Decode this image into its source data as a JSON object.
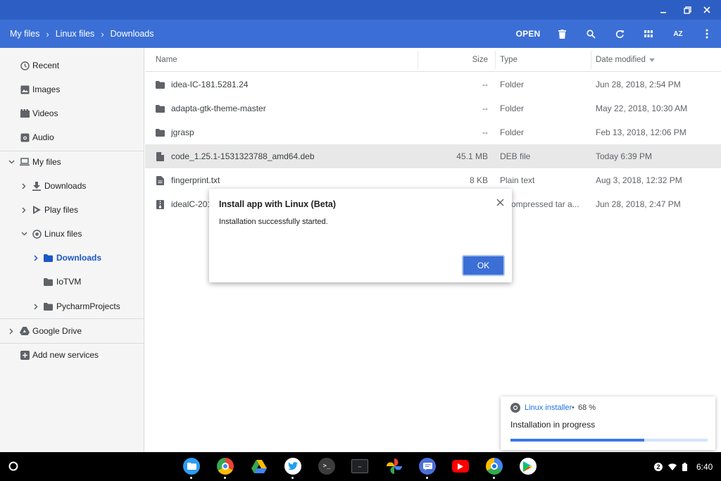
{
  "breadcrumb": {
    "items": [
      "My files",
      "Linux files",
      "Downloads"
    ]
  },
  "toolbar": {
    "open_label": "OPEN",
    "sort_label": "AZ"
  },
  "sidebar": {
    "items": [
      {
        "label": "Recent",
        "icon": "clock-icon"
      },
      {
        "label": "Images",
        "icon": "image-icon"
      },
      {
        "label": "Videos",
        "icon": "video-icon"
      },
      {
        "label": "Audio",
        "icon": "audio-icon"
      },
      {
        "label": "My files",
        "icon": "laptop-icon"
      },
      {
        "label": "Downloads",
        "icon": "download-icon"
      },
      {
        "label": "Play files",
        "icon": "play-store-icon"
      },
      {
        "label": "Linux files",
        "icon": "linux-icon"
      },
      {
        "label": "Downloads",
        "icon": "folder-icon"
      },
      {
        "label": "IoTVM",
        "icon": "folder-icon"
      },
      {
        "label": "PycharmProjects",
        "icon": "folder-icon"
      },
      {
        "label": "Google Drive",
        "icon": "drive-icon"
      },
      {
        "label": "Add new services",
        "icon": "add-box-icon"
      }
    ]
  },
  "columns": {
    "name": "Name",
    "size": "Size",
    "type": "Type",
    "date": "Date modified"
  },
  "files": [
    {
      "name": "idea-IC-181.5281.24",
      "size": "--",
      "type": "Folder",
      "date": "Jun 28, 2018, 2:54 PM",
      "icon": "folder-icon"
    },
    {
      "name": "adapta-gtk-theme-master",
      "size": "--",
      "type": "Folder",
      "date": "May 22, 2018, 10:30 AM",
      "icon": "folder-icon"
    },
    {
      "name": "jgrasp",
      "size": "--",
      "type": "Folder",
      "date": "Feb 13, 2018, 12:06 PM",
      "icon": "folder-icon"
    },
    {
      "name": "code_1.25.1-1531323788_amd64.deb",
      "size": "45.1 MB",
      "type": "DEB file",
      "date": "Today 6:39 PM",
      "icon": "file-icon"
    },
    {
      "name": "fingerprint.txt",
      "size": "8 KB",
      "type": "Plain text",
      "date": "Aug 3, 2018, 12:32 PM",
      "icon": "text-file-icon"
    },
    {
      "name": "idealC-201",
      "size": "",
      "type": "p compressed tar a...",
      "date": "Jun 28, 2018, 2:47 PM",
      "icon": "archive-icon"
    }
  ],
  "dialog": {
    "title": "Install app with Linux (Beta)",
    "message": "Installation successfully started.",
    "ok_label": "OK"
  },
  "notification": {
    "app": "Linux installer",
    "separator": "•",
    "percent_text": "68 %",
    "progress": 0.68,
    "message": "Installation in progress"
  },
  "shelf": {
    "apps": [
      "files-app-icon",
      "chrome-icon",
      "google-drive-icon",
      "twitter-icon",
      "terminal-icon",
      "crosh-icon",
      "photos-icon",
      "messages-icon",
      "youtube-icon",
      "chrome-beta-icon",
      "play-store-icon"
    ],
    "notification_count": "2",
    "time": "6:40"
  },
  "colors": {
    "appbar": "#3b6fd6",
    "titlebar": "#2d5ec3",
    "accent": "#1a57c7",
    "selected_row": "#e8e8e8"
  }
}
